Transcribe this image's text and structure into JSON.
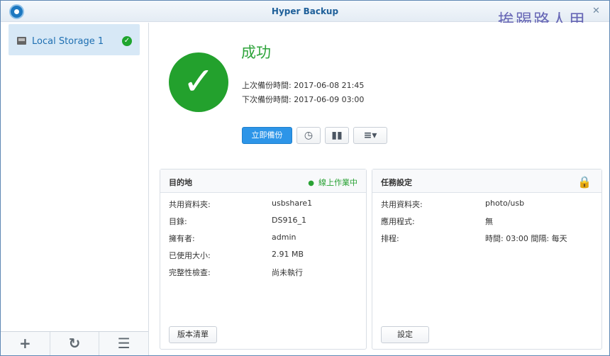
{
  "window": {
    "title": "Hyper Backup",
    "watermark": "挨踢路人甲",
    "controls": {
      "close": "✕"
    }
  },
  "sidebar": {
    "items": [
      {
        "label": "Local Storage 1",
        "status_icon": "check-circle-icon"
      }
    ],
    "footer": [
      {
        "icon": "plus-icon",
        "glyph": "+"
      },
      {
        "icon": "restore-history-icon",
        "glyph": "↻"
      },
      {
        "icon": "log-document-icon",
        "glyph": "☰"
      }
    ]
  },
  "main": {
    "status": "成功",
    "last_backup_label": "上次備份時間: 2017-06-08 21:45",
    "next_backup_label": "下次備份時間: 2017-06-09 03:00",
    "actions": {
      "backup_now": "立即備份"
    }
  },
  "destination_panel": {
    "title": "目的地",
    "online_status": "線上作業中",
    "rows": [
      {
        "label": "共用資料夾:",
        "value": "usbshare1"
      },
      {
        "label": "目錄:",
        "value": "DS916_1"
      },
      {
        "label": "擁有者:",
        "value": "admin"
      },
      {
        "label": "已使用大小:",
        "value": "2.91 MB"
      },
      {
        "label": "完整性檢查:",
        "value": "尚未執行"
      }
    ],
    "button": "版本清單"
  },
  "task_panel": {
    "title": "任務設定",
    "rows": [
      {
        "label": "共用資料夾:",
        "value": "photo/usb"
      },
      {
        "label": "應用程式:",
        "value": "無"
      },
      {
        "label": "排程:",
        "value": "時間: 03:00 間隔: 每天"
      }
    ],
    "button": "設定"
  }
}
